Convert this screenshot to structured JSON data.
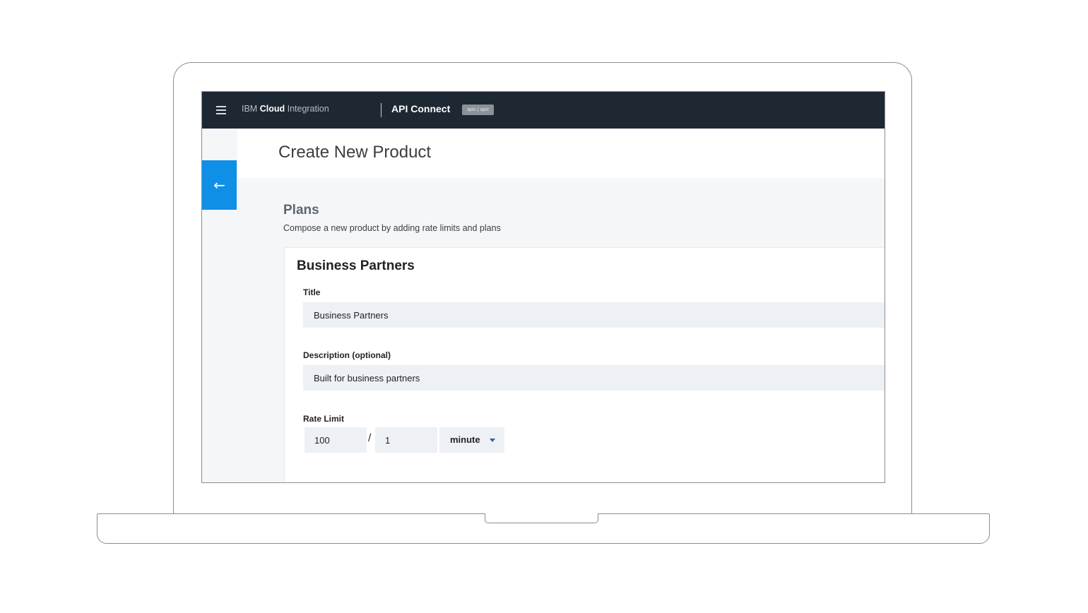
{
  "header": {
    "brand_prefix": "IBM ",
    "brand_bold": "Cloud",
    "brand_suffix": " Integration",
    "product": "API Connect",
    "badge": "apic | apic"
  },
  "page": {
    "title": "Create New Product"
  },
  "plans": {
    "title": "Plans",
    "description": "Compose a new product by adding rate limits and plans"
  },
  "card": {
    "title": "Business Partners",
    "title_label": "Title",
    "title_value": "Business Partners",
    "description_label": "Description (optional)",
    "description_value": "Built for business partners",
    "rate_limit_label": "Rate Limit",
    "rate_count": "100",
    "rate_separator": "/",
    "rate_interval": "1",
    "rate_unit": "minute"
  },
  "colors": {
    "header_bg": "#1d2833",
    "accent": "#0f8fe6",
    "field_bg": "#edf1f6"
  },
  "icons": {
    "menu": "hamburger-menu-icon",
    "back": "arrow-left-icon",
    "dropdown": "caret-down-icon"
  }
}
